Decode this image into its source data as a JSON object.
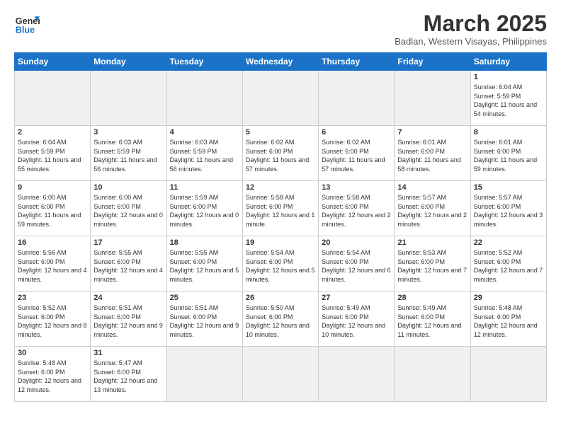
{
  "header": {
    "logo_general": "General",
    "logo_blue": "Blue",
    "title": "March 2025",
    "subtitle": "Badlan, Western Visayas, Philippines"
  },
  "days_of_week": [
    "Sunday",
    "Monday",
    "Tuesday",
    "Wednesday",
    "Thursday",
    "Friday",
    "Saturday"
  ],
  "weeks": [
    [
      {
        "day": "",
        "info": "",
        "empty": true
      },
      {
        "day": "",
        "info": "",
        "empty": true
      },
      {
        "day": "",
        "info": "",
        "empty": true
      },
      {
        "day": "",
        "info": "",
        "empty": true
      },
      {
        "day": "",
        "info": "",
        "empty": true
      },
      {
        "day": "",
        "info": "",
        "empty": true
      },
      {
        "day": "1",
        "info": "Sunrise: 6:04 AM\nSunset: 5:59 PM\nDaylight: 11 hours\nand 54 minutes.",
        "empty": false
      }
    ],
    [
      {
        "day": "2",
        "info": "Sunrise: 6:04 AM\nSunset: 5:59 PM\nDaylight: 11 hours\nand 55 minutes.",
        "empty": false
      },
      {
        "day": "3",
        "info": "Sunrise: 6:03 AM\nSunset: 5:59 PM\nDaylight: 11 hours\nand 56 minutes.",
        "empty": false
      },
      {
        "day": "4",
        "info": "Sunrise: 6:03 AM\nSunset: 5:59 PM\nDaylight: 11 hours\nand 56 minutes.",
        "empty": false
      },
      {
        "day": "5",
        "info": "Sunrise: 6:02 AM\nSunset: 6:00 PM\nDaylight: 11 hours\nand 57 minutes.",
        "empty": false
      },
      {
        "day": "6",
        "info": "Sunrise: 6:02 AM\nSunset: 6:00 PM\nDaylight: 11 hours\nand 57 minutes.",
        "empty": false
      },
      {
        "day": "7",
        "info": "Sunrise: 6:01 AM\nSunset: 6:00 PM\nDaylight: 11 hours\nand 58 minutes.",
        "empty": false
      },
      {
        "day": "8",
        "info": "Sunrise: 6:01 AM\nSunset: 6:00 PM\nDaylight: 11 hours\nand 59 minutes.",
        "empty": false
      }
    ],
    [
      {
        "day": "9",
        "info": "Sunrise: 6:00 AM\nSunset: 6:00 PM\nDaylight: 11 hours\nand 59 minutes.",
        "empty": false
      },
      {
        "day": "10",
        "info": "Sunrise: 6:00 AM\nSunset: 6:00 PM\nDaylight: 12 hours\nand 0 minutes.",
        "empty": false
      },
      {
        "day": "11",
        "info": "Sunrise: 5:59 AM\nSunset: 6:00 PM\nDaylight: 12 hours\nand 0 minutes.",
        "empty": false
      },
      {
        "day": "12",
        "info": "Sunrise: 5:58 AM\nSunset: 6:00 PM\nDaylight: 12 hours\nand 1 minute.",
        "empty": false
      },
      {
        "day": "13",
        "info": "Sunrise: 5:58 AM\nSunset: 6:00 PM\nDaylight: 12 hours\nand 2 minutes.",
        "empty": false
      },
      {
        "day": "14",
        "info": "Sunrise: 5:57 AM\nSunset: 6:00 PM\nDaylight: 12 hours\nand 2 minutes.",
        "empty": false
      },
      {
        "day": "15",
        "info": "Sunrise: 5:57 AM\nSunset: 6:00 PM\nDaylight: 12 hours\nand 3 minutes.",
        "empty": false
      }
    ],
    [
      {
        "day": "16",
        "info": "Sunrise: 5:56 AM\nSunset: 6:00 PM\nDaylight: 12 hours\nand 4 minutes.",
        "empty": false
      },
      {
        "day": "17",
        "info": "Sunrise: 5:55 AM\nSunset: 6:00 PM\nDaylight: 12 hours\nand 4 minutes.",
        "empty": false
      },
      {
        "day": "18",
        "info": "Sunrise: 5:55 AM\nSunset: 6:00 PM\nDaylight: 12 hours\nand 5 minutes.",
        "empty": false
      },
      {
        "day": "19",
        "info": "Sunrise: 5:54 AM\nSunset: 6:00 PM\nDaylight: 12 hours\nand 5 minutes.",
        "empty": false
      },
      {
        "day": "20",
        "info": "Sunrise: 5:54 AM\nSunset: 6:00 PM\nDaylight: 12 hours\nand 6 minutes.",
        "empty": false
      },
      {
        "day": "21",
        "info": "Sunrise: 5:53 AM\nSunset: 6:00 PM\nDaylight: 12 hours\nand 7 minutes.",
        "empty": false
      },
      {
        "day": "22",
        "info": "Sunrise: 5:52 AM\nSunset: 6:00 PM\nDaylight: 12 hours\nand 7 minutes.",
        "empty": false
      }
    ],
    [
      {
        "day": "23",
        "info": "Sunrise: 5:52 AM\nSunset: 6:00 PM\nDaylight: 12 hours\nand 8 minutes.",
        "empty": false
      },
      {
        "day": "24",
        "info": "Sunrise: 5:51 AM\nSunset: 6:00 PM\nDaylight: 12 hours\nand 9 minutes.",
        "empty": false
      },
      {
        "day": "25",
        "info": "Sunrise: 5:51 AM\nSunset: 6:00 PM\nDaylight: 12 hours\nand 9 minutes.",
        "empty": false
      },
      {
        "day": "26",
        "info": "Sunrise: 5:50 AM\nSunset: 6:00 PM\nDaylight: 12 hours\nand 10 minutes.",
        "empty": false
      },
      {
        "day": "27",
        "info": "Sunrise: 5:49 AM\nSunset: 6:00 PM\nDaylight: 12 hours\nand 10 minutes.",
        "empty": false
      },
      {
        "day": "28",
        "info": "Sunrise: 5:49 AM\nSunset: 6:00 PM\nDaylight: 12 hours\nand 11 minutes.",
        "empty": false
      },
      {
        "day": "29",
        "info": "Sunrise: 5:48 AM\nSunset: 6:00 PM\nDaylight: 12 hours\nand 12 minutes.",
        "empty": false
      }
    ],
    [
      {
        "day": "30",
        "info": "Sunrise: 5:48 AM\nSunset: 6:00 PM\nDaylight: 12 hours\nand 12 minutes.",
        "empty": false
      },
      {
        "day": "31",
        "info": "Sunrise: 5:47 AM\nSunset: 6:00 PM\nDaylight: 12 hours\nand 13 minutes.",
        "empty": false
      },
      {
        "day": "",
        "info": "",
        "empty": true
      },
      {
        "day": "",
        "info": "",
        "empty": true
      },
      {
        "day": "",
        "info": "",
        "empty": true
      },
      {
        "day": "",
        "info": "",
        "empty": true
      },
      {
        "day": "",
        "info": "",
        "empty": true
      }
    ]
  ]
}
